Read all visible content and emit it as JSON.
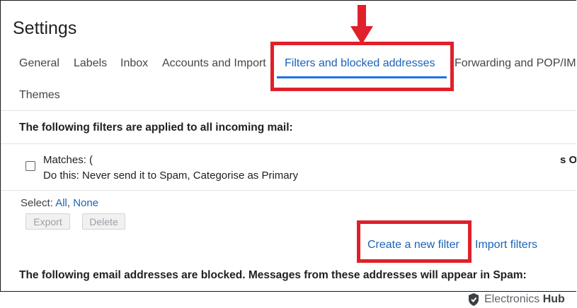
{
  "page": {
    "title": "Settings"
  },
  "tabs": [
    {
      "label": "General"
    },
    {
      "label": "Labels"
    },
    {
      "label": "Inbox"
    },
    {
      "label": "Accounts and Import"
    },
    {
      "label": "Filters and blocked addresses",
      "active": true
    },
    {
      "label": "Forwarding and POP/IM"
    },
    {
      "label": "Themes"
    }
  ],
  "filters": {
    "heading": "The following filters are applied to all incoming mail:",
    "items": [
      {
        "matches": "Matches: (",
        "action": "Do this: Never send it to Spam, Categorise as Primary",
        "trailing": "s O"
      }
    ],
    "select_label": "Select:",
    "select_all": "All",
    "select_separator": ",",
    "select_none": "None",
    "export_label": "Export",
    "delete_label": "Delete",
    "create_label": "Create a new filter",
    "import_label": "Import filters"
  },
  "blocked": {
    "heading": "The following email addresses are blocked. Messages from these addresses will appear in Spam:"
  },
  "annotations": {
    "highlight_color": "#e0202a"
  },
  "watermark": {
    "brand_light": "Electronics",
    "brand_bold": "Hub"
  }
}
